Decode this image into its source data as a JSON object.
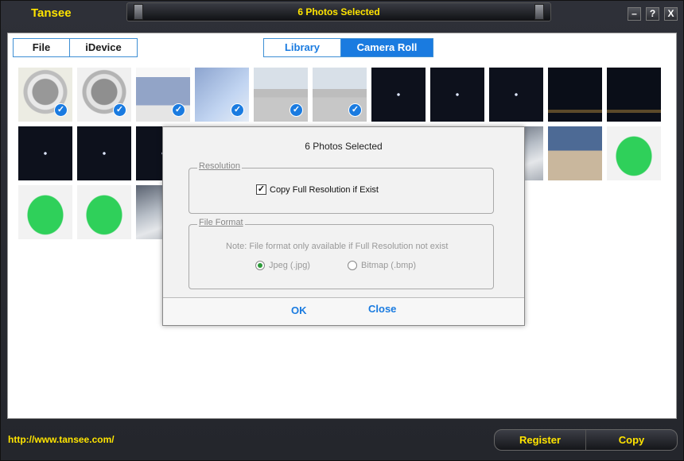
{
  "app": {
    "name": "Tansee",
    "status": "6 Photos Selected",
    "url": "http://www.tansee.com/"
  },
  "window_controls": {
    "minimize": "–",
    "help": "?",
    "close": "X"
  },
  "source_tabs": [
    {
      "label": "File"
    },
    {
      "label": "iDevice"
    }
  ],
  "view_tabs": [
    {
      "label": "Library"
    },
    {
      "label": "Camera Roll",
      "active": true
    }
  ],
  "thumbnails": [
    {
      "kind": "dart",
      "selected": true
    },
    {
      "kind": "dart2",
      "selected": true
    },
    {
      "kind": "screen",
      "selected": true
    },
    {
      "kind": "blue",
      "selected": true
    },
    {
      "kind": "street",
      "selected": true
    },
    {
      "kind": "street",
      "selected": true
    },
    {
      "kind": "night",
      "selected": false
    },
    {
      "kind": "night",
      "selected": false
    },
    {
      "kind": "night",
      "selected": false
    },
    {
      "kind": "lights",
      "selected": false
    },
    {
      "kind": "lights",
      "selected": false
    },
    {
      "kind": "night",
      "selected": false
    },
    {
      "kind": "night",
      "selected": false
    },
    {
      "kind": "night",
      "selected": false
    },
    {
      "kind": "frog",
      "selected": false
    },
    {
      "kind": "frog",
      "selected": false
    },
    {
      "kind": "frog",
      "selected": false
    },
    {
      "kind": "sky",
      "selected": false
    },
    {
      "kind": "sky",
      "selected": false
    },
    {
      "kind": "sky",
      "selected": false
    },
    {
      "kind": "build",
      "selected": false
    },
    {
      "kind": "frog",
      "selected": false
    },
    {
      "kind": "frog",
      "selected": false
    },
    {
      "kind": "frog",
      "selected": false
    },
    {
      "kind": "sky",
      "selected": false
    },
    {
      "kind": "sky",
      "selected": false
    },
    {
      "kind": "build",
      "selected": false
    },
    {
      "kind": "cloud",
      "selected": false
    }
  ],
  "dialog": {
    "title": "6 Photos Selected",
    "resolution_group": "Resolution",
    "copy_full_resolution": {
      "label": "Copy Full Resolution if Exist",
      "checked": true
    },
    "format_group": "File Format",
    "format_note": "Note: File format only available if Full Resolution not exist",
    "formats": [
      {
        "label": "Jpeg (.jpg)",
        "selected": true
      },
      {
        "label": "Bitmap (.bmp)",
        "selected": false
      }
    ],
    "ok_label": "OK",
    "close_label": "Close"
  },
  "bottom": {
    "register_label": "Register",
    "copy_label": "Copy"
  }
}
